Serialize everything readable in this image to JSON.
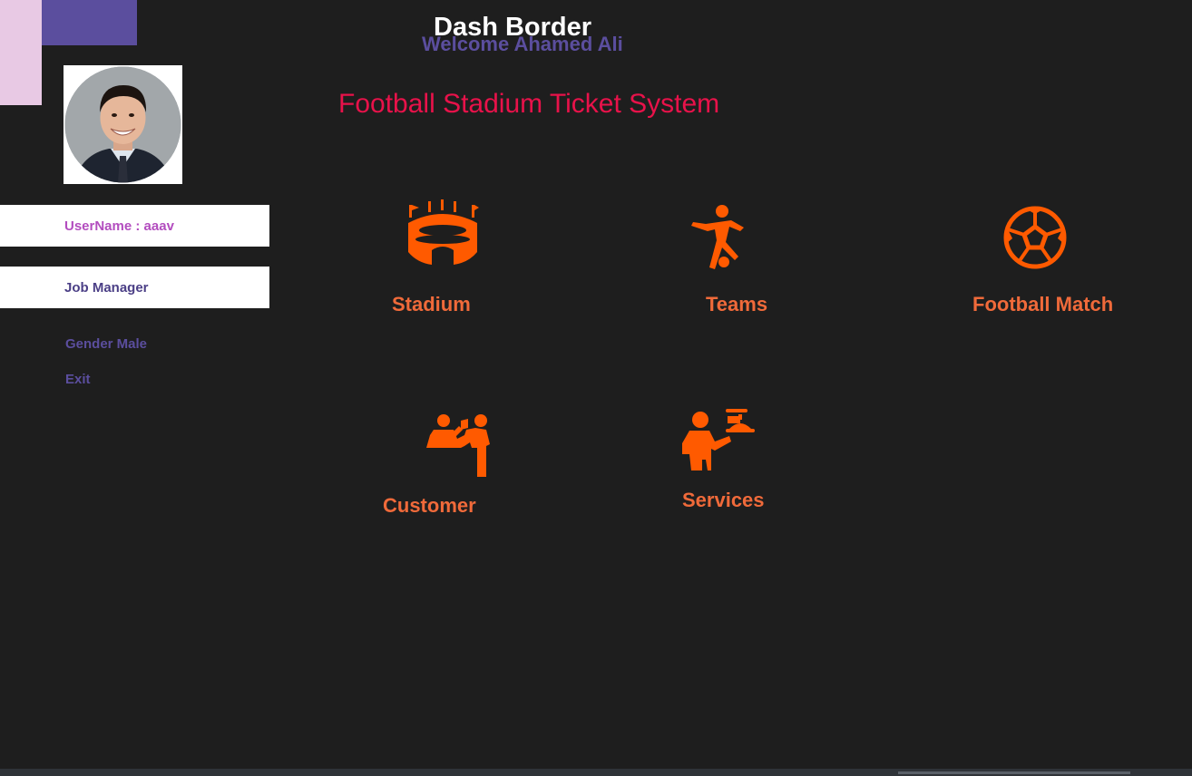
{
  "header": {
    "welcome_text": "Welcome  Ahamed Ali",
    "dash_title": "Dash Border",
    "app_title": "Football Stadium Ticket System"
  },
  "user": {
    "username_label": "UserName : aaav",
    "job_label": "Job Manager",
    "gender_label": "Gender Male",
    "exit_label": "Exit"
  },
  "tiles": [
    {
      "label": "Stadium",
      "icon": "stadium-icon"
    },
    {
      "label": "Teams",
      "icon": "player-kicking-icon"
    },
    {
      "label": "Football Match",
      "icon": "soccer-ball-icon"
    },
    {
      "label": "Customer",
      "icon": "customer-counter-icon"
    },
    {
      "label": "Services",
      "icon": "waiter-service-icon"
    }
  ],
  "colors": {
    "background": "#1e1e1e",
    "accent_purple": "#5b4e9e",
    "accent_pink": "#e8c9e4",
    "title_red": "#e8124a",
    "tile_orange": "#f06a3a",
    "icon_orange": "#ff5a00",
    "username_magenta": "#b34dbf"
  }
}
